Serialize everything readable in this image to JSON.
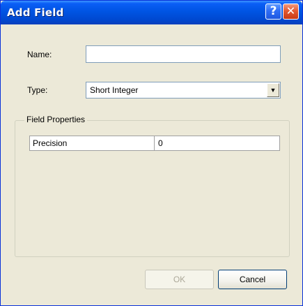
{
  "window": {
    "title": "Add Field",
    "help_glyph": "?",
    "close_glyph": "✕"
  },
  "form": {
    "name_label": "Name:",
    "name_value": "",
    "type_label": "Type:",
    "type_value": "Short Integer",
    "dropdown_glyph": "▼"
  },
  "field_properties": {
    "title": "Field Properties",
    "rows": [
      {
        "name": "Precision",
        "value": "0"
      }
    ]
  },
  "buttons": {
    "ok_label": "OK",
    "cancel_label": "Cancel"
  },
  "colors": {
    "titlebar": "#0054e3",
    "dialog_bg": "#ece9d8",
    "close_button": "#e35a32"
  }
}
